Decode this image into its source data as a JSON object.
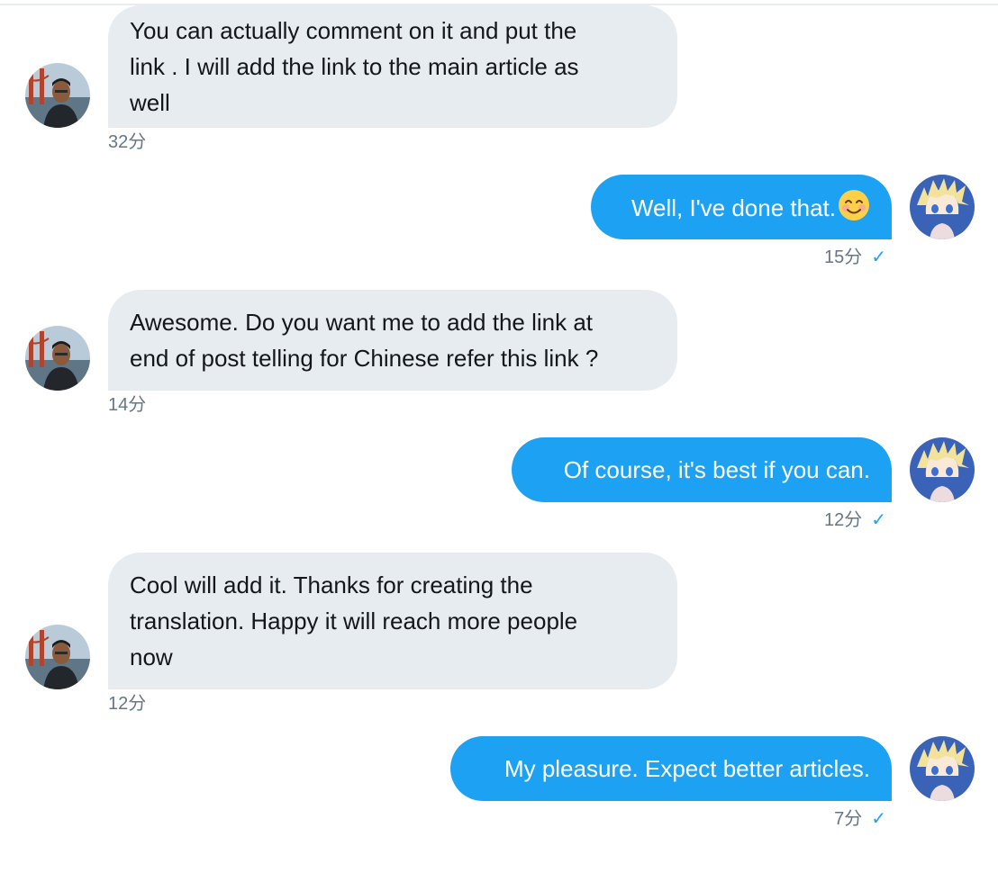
{
  "thread": {
    "messages": [
      {
        "direction": "in",
        "text_lines": [
          "You can actually comment on it and put the",
          "link . I will add the link to the main article as",
          "well"
        ],
        "time": "32分"
      },
      {
        "direction": "out",
        "text": "Well, I've done that.",
        "emoji": "smiling-face-emoji",
        "time": "15分",
        "read": true
      },
      {
        "direction": "in",
        "text_lines": [
          "Awesome. Do you want me to add the link at",
          "end of post telling for Chinese refer this link ?"
        ],
        "time": "14分"
      },
      {
        "direction": "out",
        "text": "Of course, it's best if you can.",
        "time": "12分",
        "read": true
      },
      {
        "direction": "in",
        "text_lines": [
          "Cool will add it. Thanks for creating the",
          "translation. Happy it will reach more people",
          "now"
        ],
        "time": "12分"
      },
      {
        "direction": "out",
        "text": "My pleasure. Expect better articles.",
        "time": "7分",
        "read": true
      }
    ],
    "read_mark": "✓"
  },
  "colors": {
    "incoming_bubble": "#e6ecf0",
    "outgoing_bubble": "#1da1f2",
    "timestamp": "#657786",
    "check": "#1da1f2"
  }
}
